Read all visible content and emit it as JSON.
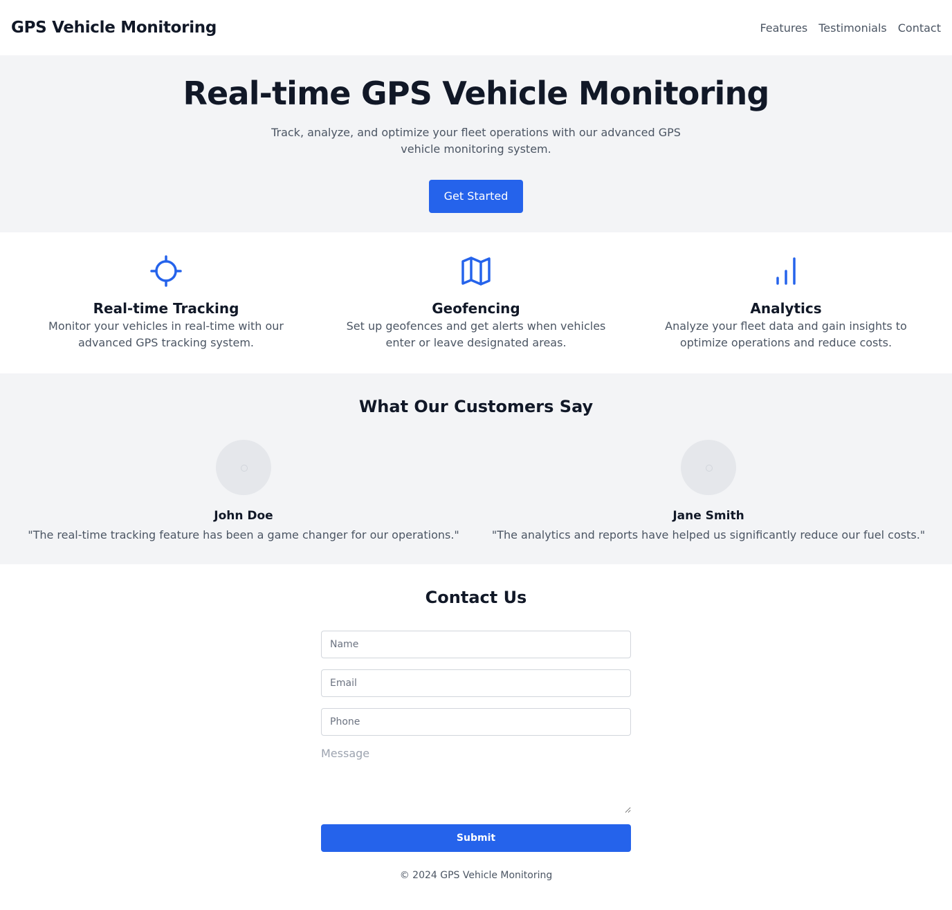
{
  "header": {
    "brand": "GPS Vehicle Monitoring",
    "nav": [
      "Features",
      "Testimonials",
      "Contact"
    ]
  },
  "hero": {
    "title": "Real-time GPS Vehicle Monitoring",
    "subtitle": "Track, analyze, and optimize your fleet operations with our advanced GPS vehicle monitoring system.",
    "cta": "Get Started"
  },
  "features": [
    {
      "icon": "crosshair-icon",
      "title": "Real-time Tracking",
      "text": "Monitor your vehicles in real-time with our advanced GPS tracking system."
    },
    {
      "icon": "map-icon",
      "title": "Geofencing",
      "text": "Set up geofences and get alerts when vehicles enter or leave designated areas."
    },
    {
      "icon": "bar-chart-icon",
      "title": "Analytics",
      "text": "Analyze your fleet data and gain insights to optimize operations and reduce costs."
    }
  ],
  "testimonials": {
    "heading": "What Our Customers Say",
    "items": [
      {
        "name": "John Doe",
        "quote": "\"The real-time tracking feature has been a game changer for our operations.\""
      },
      {
        "name": "Jane Smith",
        "quote": "\"The analytics and reports have helped us significantly reduce our fuel costs.\""
      }
    ]
  },
  "contact": {
    "heading": "Contact Us",
    "name_placeholder": "Name",
    "email_placeholder": "Email",
    "phone_placeholder": "Phone",
    "message_placeholder": "Message",
    "submit": "Submit"
  },
  "footer": {
    "text": "© 2024 GPS Vehicle Monitoring"
  },
  "colors": {
    "accent": "#2563eb",
    "section_bg": "#f3f4f6",
    "heading": "#111827",
    "body_text": "#4b5563"
  }
}
